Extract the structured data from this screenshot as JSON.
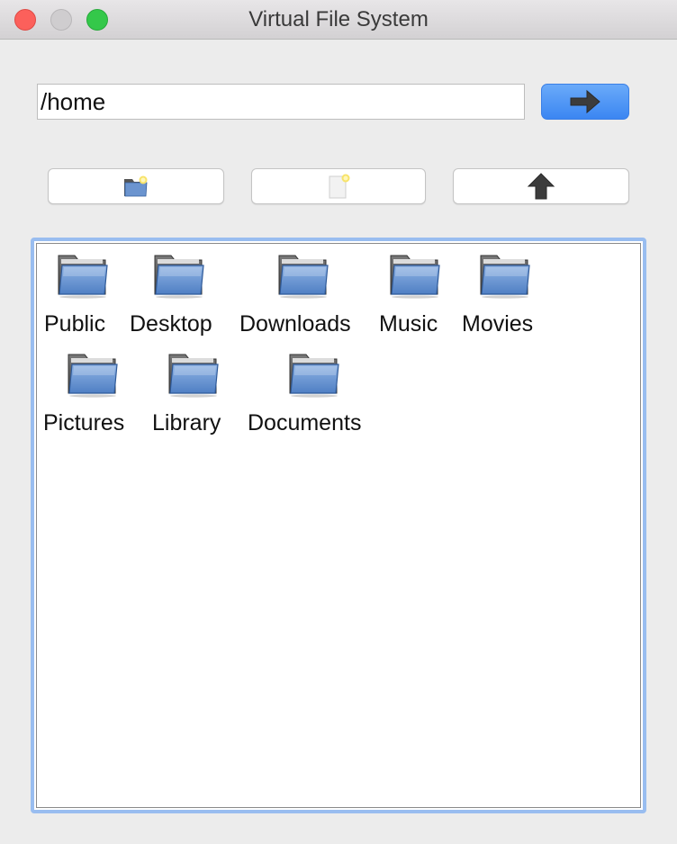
{
  "window": {
    "title": "Virtual File System"
  },
  "address_bar": {
    "path_value": "/home",
    "go_icon": "right-arrow-icon"
  },
  "toolbar": {
    "buttons": [
      {
        "icon": "new-folder-icon"
      },
      {
        "icon": "new-file-icon"
      },
      {
        "icon": "up-arrow-icon"
      }
    ]
  },
  "files": {
    "items": [
      {
        "name": "Public",
        "type": "folder"
      },
      {
        "name": "Desktop",
        "type": "folder"
      },
      {
        "name": "Downloads",
        "type": "folder"
      },
      {
        "name": "Music",
        "type": "folder"
      },
      {
        "name": "Movies",
        "type": "folder"
      },
      {
        "name": "Pictures",
        "type": "folder"
      },
      {
        "name": "Library",
        "type": "folder"
      },
      {
        "name": "Documents",
        "type": "folder"
      }
    ]
  },
  "colors": {
    "accent": "#3b86f2",
    "selection_border": "#99bdf0",
    "folder_blue": "#5f8fcf"
  }
}
